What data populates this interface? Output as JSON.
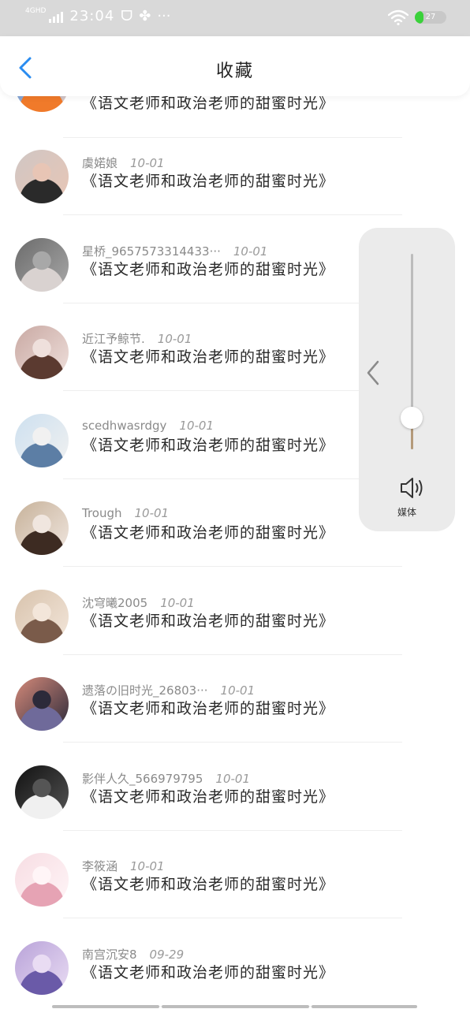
{
  "status_bar": {
    "network": "4GHD",
    "time": "23:04",
    "glyphs": [
      "ᗜ",
      "✤",
      "···"
    ],
    "battery_percent": 27,
    "battery_color": "#3ad13a",
    "background_color": "#d9d9d9"
  },
  "header": {
    "title": "收藏",
    "back_icon": "chevron-left-icon",
    "back_color": "#2a8cf0"
  },
  "list": {
    "items": [
      {
        "author": "",
        "date": "",
        "title": "《语文老师和政治老师的甜蜜时光》",
        "avatar_colors": [
          "#3a86e0",
          "#f07a2a",
          "#f3d3c2"
        ]
      },
      {
        "author": "虞婼娘",
        "date": "10-01",
        "title": "《语文老师和政治老师的甜蜜时光》",
        "avatar_colors": [
          "#d0c7c4",
          "#2a2a2a",
          "#e8c5b5"
        ]
      },
      {
        "author": "星桥_9657573314433···",
        "date": "10-01",
        "title": "《语文老师和政治老师的甜蜜时光》",
        "avatar_colors": [
          "#6b6b6b",
          "#d9d2d0",
          "#a8a8a8"
        ]
      },
      {
        "author": "近江予鲸节.",
        "date": "10-01",
        "title": "《语文老师和政治老师的甜蜜时光》",
        "avatar_colors": [
          "#c9a9a3",
          "#5b3a30",
          "#efe0dc"
        ]
      },
      {
        "author": "scedhwasrdgy",
        "date": "10-01",
        "title": "《语文老师和政治老师的甜蜜时光》",
        "avatar_colors": [
          "#cde0ef",
          "#5c7ea5",
          "#f1f1f1"
        ]
      },
      {
        "author": "Trough",
        "date": "10-01",
        "title": "《语文老师和政治老师的甜蜜时光》",
        "avatar_colors": [
          "#c7b29a",
          "#3d2b22",
          "#f0e6df"
        ]
      },
      {
        "author": "沈穹曦2005",
        "date": "10-01",
        "title": "《语文老师和政治老师的甜蜜时光》",
        "avatar_colors": [
          "#d8c3ad",
          "#7a5b4a",
          "#f3e6da"
        ]
      },
      {
        "author": "遗落の旧时光_26803···",
        "date": "10-01",
        "title": "《语文老师和政治老师的甜蜜时光》",
        "avatar_colors": [
          "#d58a7a",
          "#6f6a9a",
          "#2c2a3a"
        ]
      },
      {
        "author": "影伴人久_566979795",
        "date": "10-01",
        "title": "《语文老师和政治老师的甜蜜时光》",
        "avatar_colors": [
          "#111111",
          "#f0f0f0",
          "#555555"
        ]
      },
      {
        "author": "李筱涵",
        "date": "10-01",
        "title": "《语文老师和政治老师的甜蜜时光》",
        "avatar_colors": [
          "#f7dde3",
          "#e6a3b4",
          "#fff5f7"
        ]
      },
      {
        "author": "南宫沉安8",
        "date": "09-29",
        "title": "《语文老师和政治老师的甜蜜时光》",
        "avatar_colors": [
          "#b9a3d9",
          "#6a5aa8",
          "#e9dcf3"
        ]
      }
    ]
  },
  "volume_panel": {
    "label": "媒体",
    "level_fraction": 0.16,
    "collapse_icon": "chevron-left-icon",
    "speaker_icon": "speaker-icon",
    "track_fill_color": "#b49a7a"
  }
}
